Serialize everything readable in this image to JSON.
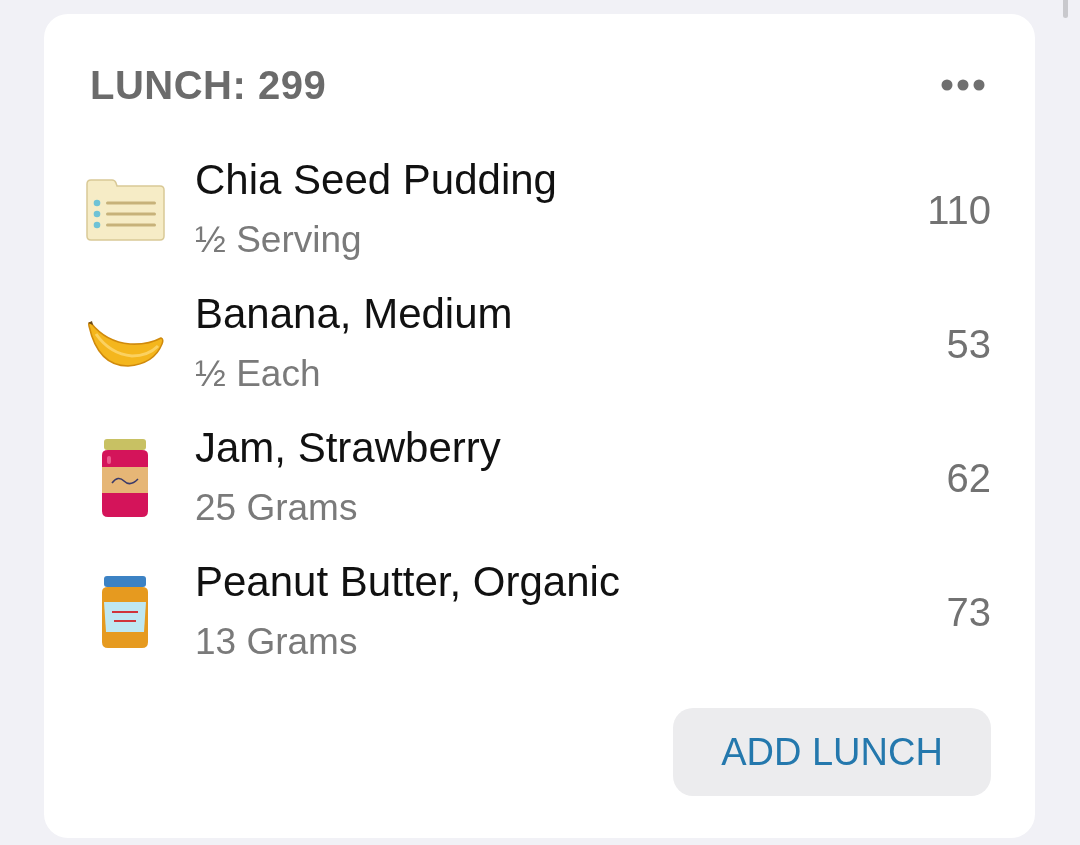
{
  "meal": {
    "title": "LUNCH: 299"
  },
  "items": [
    {
      "kind": "notes",
      "name": "Chia Seed Pudding",
      "amount": "½ Serving",
      "calories": "110"
    },
    {
      "kind": "banana",
      "name": "Banana, Medium",
      "amount": "½ Each",
      "calories": "53"
    },
    {
      "kind": "jam",
      "name": "Jam, Strawberry",
      "amount": "25 Grams",
      "calories": "62"
    },
    {
      "kind": "spread",
      "name": "Peanut Butter, Organic",
      "amount": "13 Grams",
      "calories": "73"
    }
  ],
  "add_button": {
    "label": "ADD LUNCH"
  }
}
